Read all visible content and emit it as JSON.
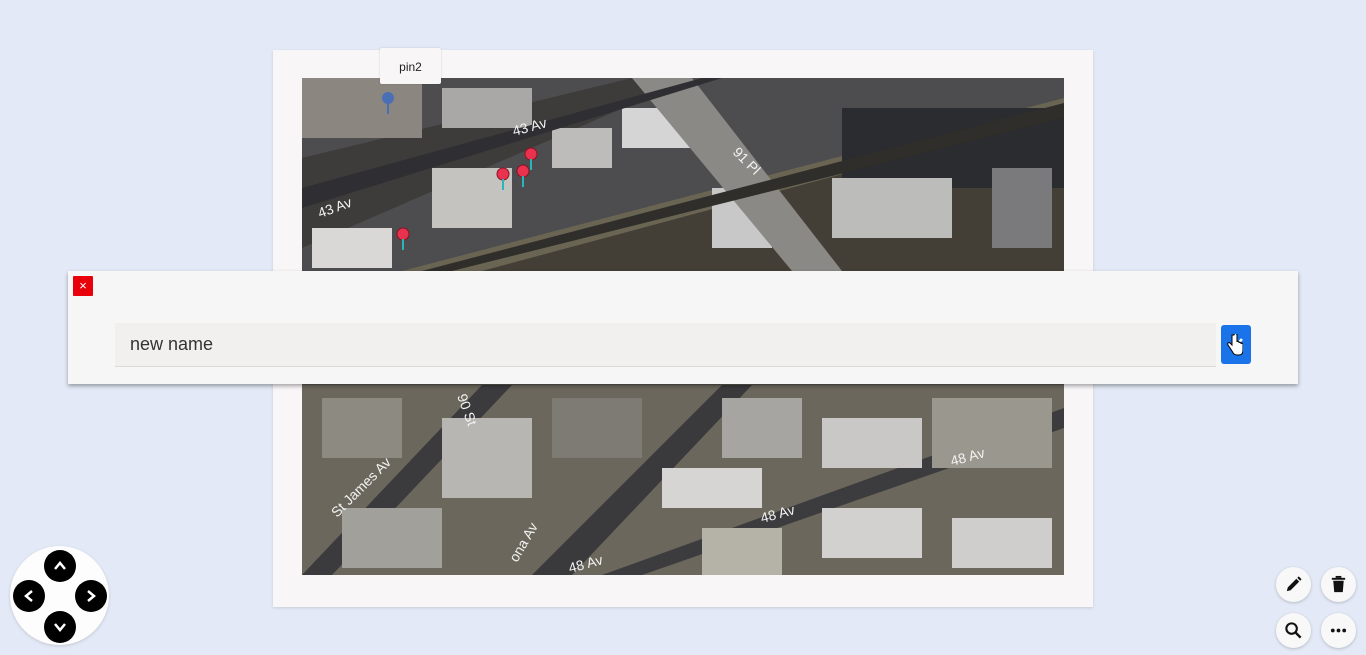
{
  "map": {
    "street_labels": [
      "43 Av",
      "43 Av",
      "91 Pl",
      "90 St",
      "St James Av",
      "48 Av",
      "48 Av",
      "48 Av",
      "ona Av"
    ],
    "tooltip_label": "pin2"
  },
  "rename_dialog": {
    "close_icon": "×",
    "input_value": "new name",
    "confirm_icon": "check-icon"
  },
  "nav": {
    "up_icon": "chevron-up-icon",
    "down_icon": "chevron-down-icon",
    "left_icon": "chevron-left-icon",
    "right_icon": "chevron-right-icon"
  },
  "actions": {
    "edit_icon": "pencil-icon",
    "delete_icon": "trash-icon",
    "search_icon": "search-icon",
    "more_icon": "more-horizontal-icon"
  },
  "colors": {
    "background": "#e3e9f6",
    "accent": "#1a73e8",
    "close": "#e8000b",
    "pin_red": "#e8324e",
    "pin_blue": "#4a6fb5"
  }
}
